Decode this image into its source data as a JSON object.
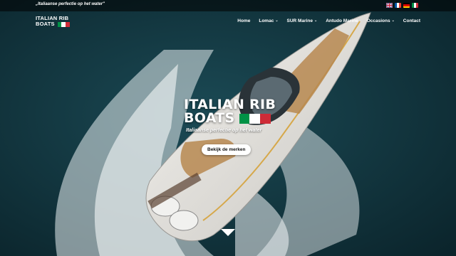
{
  "topbar": {
    "tagline": "„Italiaanse perfectie op het water\"",
    "languages": [
      {
        "name": "english-flag-icon"
      },
      {
        "name": "french-flag-icon"
      },
      {
        "name": "german-flag-icon"
      },
      {
        "name": "italian-flag-icon"
      }
    ]
  },
  "header": {
    "logo_line1": "ITALIAN RIB",
    "logo_line2": "BOATS",
    "nav": [
      {
        "label": "Home",
        "dropdown": false
      },
      {
        "label": "Lomac",
        "dropdown": true
      },
      {
        "label": "SUR Marine",
        "dropdown": true
      },
      {
        "label": "Antudo Marine",
        "dropdown": false
      },
      {
        "label": "Occasions",
        "dropdown": true
      },
      {
        "label": "Contact",
        "dropdown": false
      }
    ]
  },
  "hero": {
    "title_line1": "ITALIAN RIB",
    "title_line2": "BOATS",
    "subtitle": "Italiaanse perfectie op het water",
    "cta_label": "Bekijk de merken"
  },
  "colors": {
    "sea": "#123c45",
    "italy_green": "#009246",
    "italy_white": "#ffffff",
    "italy_red": "#ce2b37"
  }
}
